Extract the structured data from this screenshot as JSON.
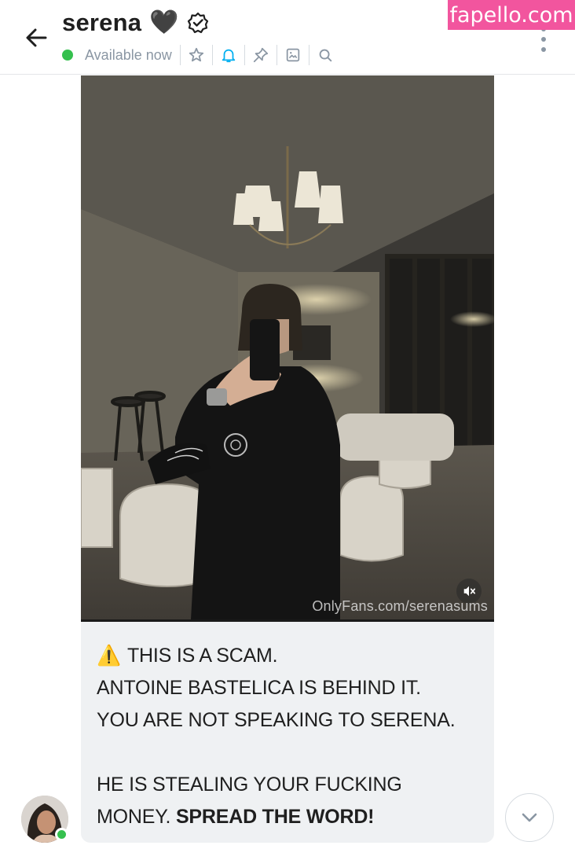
{
  "header": {
    "title": "serena",
    "heart_icon": "🖤",
    "status": "Available now",
    "icons": [
      "back-arrow-icon",
      "verified-icon",
      "star-icon",
      "bell-icon",
      "pin-icon",
      "image-icon",
      "search-icon",
      "more-vertical-icon"
    ],
    "accent_color": "#00aff0",
    "online_color": "#35c04e"
  },
  "watermark": {
    "text": "fapello.com",
    "color": "#f2559e"
  },
  "media": {
    "credit": "OnlyFans.com/serenasums",
    "mute_icon": "muted-speaker-icon"
  },
  "message": {
    "warning_icon": "⚠️",
    "line1": "THIS IS A SCAM.",
    "line2": "ANTOINE BASTELICA IS BEHIND IT.",
    "line3": "YOU ARE NOT SPEAKING TO SERENA.",
    "line4": "HE IS STEALING YOUR FUCKING",
    "line5_normal": "MONEY. ",
    "line5_bold": "SPREAD THE WORD!"
  },
  "footer": {
    "scroll_icon": "chevron-down-icon"
  }
}
